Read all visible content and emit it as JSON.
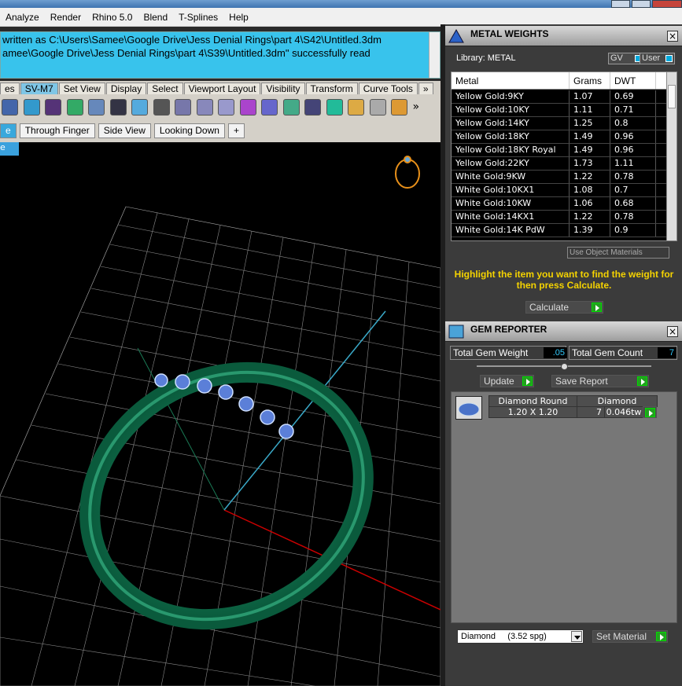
{
  "menu": [
    "Analyze",
    "Render",
    "Rhino 5.0",
    "Blend",
    "T-Splines",
    "Help"
  ],
  "command": {
    "line1": "written as C:\\Users\\Samee\\Google Drive\\Jess Denial Rings\\part 4\\S42\\Untitled.3dm",
    "line2": "amee\\Google Drive\\Jess Denial Rings\\part 4\\S39\\Untitled.3dm\" successfully read"
  },
  "toolbar_tabs": [
    "es",
    "SV-M7",
    "Set View",
    "Display",
    "Select",
    "Viewport Layout",
    "Visibility",
    "Transform",
    "Curve Tools",
    "»"
  ],
  "view_tabs": [
    "e",
    "Through Finger",
    "Side View",
    "Looking Down",
    "+"
  ],
  "viewport": {
    "dropdown": "e"
  },
  "metal_weights": {
    "title": "METAL WEIGHTS",
    "library_label": "Library: METAL",
    "gv_label": "GV",
    "user_label": "User",
    "columns": [
      "Metal",
      "Grams",
      "DWT"
    ],
    "rows": [
      [
        "Yellow Gold:9KY",
        "1.07",
        "0.69"
      ],
      [
        "Yellow Gold:10KY",
        "1.11",
        "0.71"
      ],
      [
        "Yellow Gold:14KY",
        "1.25",
        "0.8"
      ],
      [
        "Yellow Gold:18KY",
        "1.49",
        "0.96"
      ],
      [
        "Yellow Gold:18KY Royal",
        "1.49",
        "0.96"
      ],
      [
        "Yellow Gold:22KY",
        "1.73",
        "1.11"
      ],
      [
        "White Gold:9KW",
        "1.22",
        "0.78"
      ],
      [
        "White Gold:10KX1",
        "1.08",
        "0.7"
      ],
      [
        "White Gold:10KW",
        "1.06",
        "0.68"
      ],
      [
        "White Gold:14KX1",
        "1.22",
        "0.78"
      ],
      [
        "White Gold:14K PdW",
        "1.39",
        "0.9"
      ]
    ],
    "use_object_materials": "Use Object Materials",
    "hint": "Highlight the item you want to find the weight for then press Calculate.",
    "calculate": "Calculate"
  },
  "gem_reporter": {
    "title": "GEM REPORTER",
    "total_weight_label": "Total Gem Weight",
    "total_weight_value": ".05",
    "total_count_label": "Total Gem Count",
    "total_count_value": "7",
    "update": "Update",
    "save_report": "Save Report",
    "gems": [
      {
        "shape": "Diamond Round",
        "size": "1.20 X 1.20",
        "material": "Diamond",
        "count": "7",
        "weight": "0.046tw"
      }
    ],
    "material_select": "Diamond     (3.52 spg)",
    "set_material": "Set Material"
  }
}
